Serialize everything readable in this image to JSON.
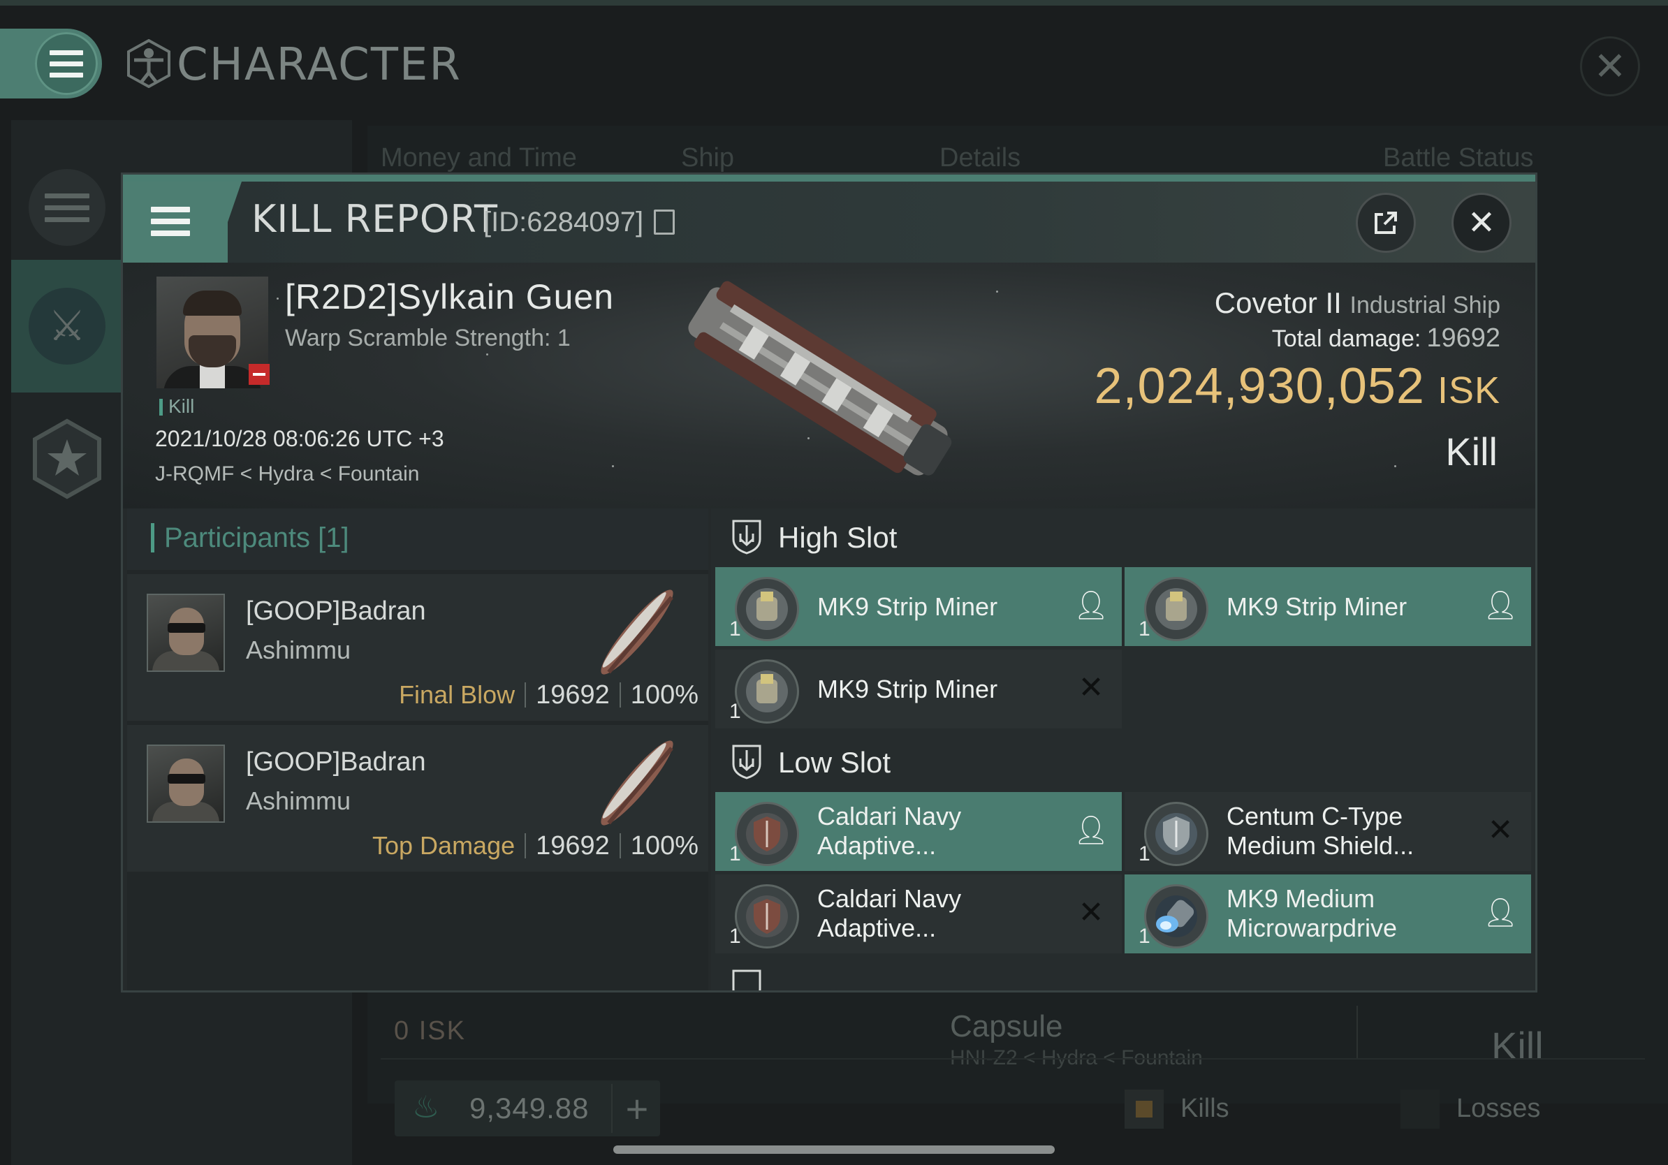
{
  "app": {
    "title": "CHARACTER",
    "icons": {
      "menu": "menu-icon",
      "character": "vitruvian-icon",
      "close": "close-icon"
    }
  },
  "sidebar": {
    "items": [
      {
        "icon": "list-icon"
      },
      {
        "icon": "crossed-swords-icon",
        "active": true
      },
      {
        "icon": "star-icon"
      }
    ]
  },
  "background": {
    "tabs": [
      "Money and Time",
      "Ship",
      "Details",
      "Battle Status"
    ],
    "row": {
      "isk": "0  ISK",
      "ship": "Capsule",
      "ship_sub": "HNI-Z2 < Hydra < Fountain",
      "status": "Kill"
    },
    "wallet": {
      "value": "9,349.88",
      "plus": "+"
    },
    "legend": {
      "kills": "Kills",
      "losses": "Losses"
    }
  },
  "kill_report": {
    "title": "KILL REPORT",
    "id": "[ID:6284097]",
    "victim": {
      "name": "[R2D2]Sylkain Guen",
      "warp": "Warp Scramble Strength: 1",
      "tag": "Kill",
      "datetime": "2021/10/28 08:06:26 UTC +3",
      "location": "J-RQMF < Hydra < Fountain"
    },
    "ship": {
      "name": "Covetor II",
      "class": "Industrial Ship",
      "total_damage_label": "Total damage:",
      "total_damage": "19692",
      "isk": "2,024,930,052",
      "isk_unit": "ISK",
      "result": "Kill"
    },
    "participants": {
      "title": "Participants [1]",
      "rows": [
        {
          "name": "[GOOP]Badran",
          "ship": "Ashimmu",
          "tag": "Final Blow",
          "damage": "19692",
          "percent": "100%"
        },
        {
          "name": "[GOOP]Badran",
          "ship": "Ashimmu",
          "tag": "Top Damage",
          "damage": "19692",
          "percent": "100%"
        }
      ]
    },
    "slots": {
      "high": {
        "label": "High Slot",
        "items": [
          {
            "qty": "1",
            "name": "MK9 Strip Miner",
            "state": "dropped"
          },
          {
            "qty": "1",
            "name": "MK9 Strip Miner",
            "state": "dropped"
          },
          {
            "qty": "1",
            "name": "MK9 Strip Miner",
            "state": "destroyed"
          }
        ]
      },
      "low": {
        "label": "Low Slot",
        "items": [
          {
            "qty": "1",
            "name": "Caldari Navy\nAdaptive...",
            "state": "dropped"
          },
          {
            "qty": "1",
            "name": "Centum C-Type\nMedium Shield...",
            "state": "destroyed"
          },
          {
            "qty": "1",
            "name": "Caldari Navy\nAdaptive...",
            "state": "destroyed"
          },
          {
            "qty": "1",
            "name": "MK9 Medium\nMicrowarpdrive",
            "state": "dropped"
          }
        ]
      }
    },
    "colors": {
      "accent": "#4d7e72",
      "isk": "#e7c27a",
      "tag": "#c9a862",
      "destroyed_bg": "#2b3132",
      "dropped_bg": "#4a7c70"
    }
  }
}
